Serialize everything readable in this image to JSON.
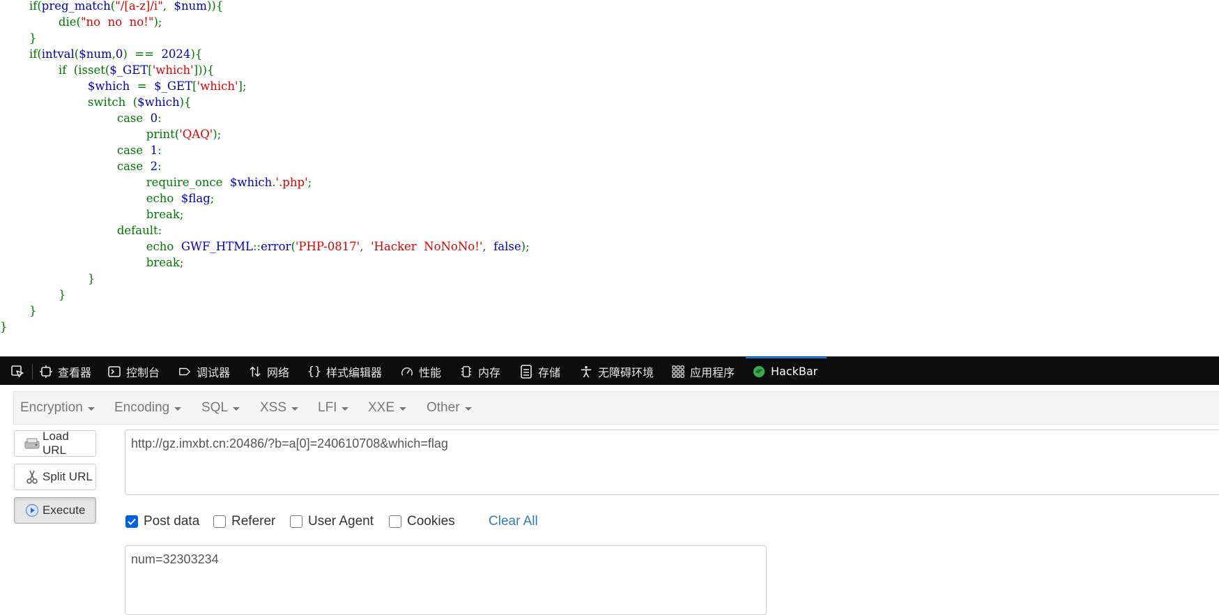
{
  "code": {
    "lines": [
      [
        {
          "t": "        if(",
          "c": "g"
        },
        {
          "t": "preg_match",
          "c": "b"
        },
        {
          "t": "(",
          "c": "g"
        },
        {
          "t": "\"/[a-z]/i\"",
          "c": "r"
        },
        {
          "t": ",  ",
          "c": "g"
        },
        {
          "t": "$num",
          "c": "b"
        },
        {
          "t": ")){",
          "c": "g"
        }
      ],
      [
        {
          "t": "                die(",
          "c": "g"
        },
        {
          "t": "\"no  no  no!\"",
          "c": "r"
        },
        {
          "t": ");",
          "c": "g"
        }
      ],
      [
        {
          "t": "        }",
          "c": "g"
        }
      ],
      [
        {
          "t": "        if(",
          "c": "g"
        },
        {
          "t": "intval",
          "c": "b"
        },
        {
          "t": "(",
          "c": "g"
        },
        {
          "t": "$num",
          "c": "b"
        },
        {
          "t": ",",
          "c": "g"
        },
        {
          "t": "0",
          "c": "b"
        },
        {
          "t": ")  ==  ",
          "c": "g"
        },
        {
          "t": "2024",
          "c": "b"
        },
        {
          "t": "){",
          "c": "g"
        }
      ],
      [
        {
          "t": "                if  (isset(",
          "c": "g"
        },
        {
          "t": "$_GET",
          "c": "b"
        },
        {
          "t": "[",
          "c": "g"
        },
        {
          "t": "'which'",
          "c": "r"
        },
        {
          "t": "])){",
          "c": "g"
        }
      ],
      [
        {
          "t": "                        ",
          "c": "g"
        },
        {
          "t": "$which",
          "c": "b"
        },
        {
          "t": "  =  ",
          "c": "g"
        },
        {
          "t": "$_GET",
          "c": "b"
        },
        {
          "t": "[",
          "c": "g"
        },
        {
          "t": "'which'",
          "c": "r"
        },
        {
          "t": "];",
          "c": "g"
        }
      ],
      [
        {
          "t": "                        switch  (",
          "c": "g"
        },
        {
          "t": "$which",
          "c": "b"
        },
        {
          "t": "){",
          "c": "g"
        }
      ],
      [
        {
          "t": "                                case  ",
          "c": "g"
        },
        {
          "t": "0",
          "c": "b"
        },
        {
          "t": ":",
          "c": "g"
        }
      ],
      [
        {
          "t": "                                        print(",
          "c": "g"
        },
        {
          "t": "'QAQ'",
          "c": "r"
        },
        {
          "t": ");",
          "c": "g"
        }
      ],
      [
        {
          "t": "                                case  ",
          "c": "g"
        },
        {
          "t": "1",
          "c": "b"
        },
        {
          "t": ":",
          "c": "g"
        }
      ],
      [
        {
          "t": "                                case  ",
          "c": "g"
        },
        {
          "t": "2",
          "c": "b"
        },
        {
          "t": ":",
          "c": "g"
        }
      ],
      [
        {
          "t": "                                        require_once  ",
          "c": "g"
        },
        {
          "t": "$which",
          "c": "b"
        },
        {
          "t": ".",
          "c": "g"
        },
        {
          "t": "'.php'",
          "c": "r"
        },
        {
          "t": ";",
          "c": "g"
        }
      ],
      [
        {
          "t": "                                        echo  ",
          "c": "g"
        },
        {
          "t": "$flag",
          "c": "b"
        },
        {
          "t": ";",
          "c": "g"
        }
      ],
      [
        {
          "t": "                                        break;",
          "c": "g"
        }
      ],
      [
        {
          "t": "                                default:",
          "c": "g"
        }
      ],
      [
        {
          "t": "                                        echo  ",
          "c": "g"
        },
        {
          "t": "GWF_HTML",
          "c": "b"
        },
        {
          "t": "::",
          "c": "g"
        },
        {
          "t": "error",
          "c": "b"
        },
        {
          "t": "(",
          "c": "g"
        },
        {
          "t": "'PHP-0817'",
          "c": "r"
        },
        {
          "t": ",  ",
          "c": "g"
        },
        {
          "t": "'Hacker  NoNoNo!'",
          "c": "r"
        },
        {
          "t": ",  ",
          "c": "g"
        },
        {
          "t": "false",
          "c": "b"
        },
        {
          "t": ");",
          "c": "g"
        }
      ],
      [
        {
          "t": "                                        break;",
          "c": "g"
        }
      ],
      [
        {
          "t": "                        }",
          "c": "g"
        }
      ],
      [
        {
          "t": "                }",
          "c": "g"
        }
      ],
      [
        {
          "t": "        }",
          "c": "g"
        }
      ],
      [
        {
          "t": "}",
          "c": "g"
        }
      ]
    ]
  },
  "devtools": {
    "tabs": [
      {
        "label": "查看器",
        "icon": "inspector-icon"
      },
      {
        "label": "控制台",
        "icon": "console-icon"
      },
      {
        "label": "调试器",
        "icon": "debugger-icon"
      },
      {
        "label": "网络",
        "icon": "network-icon"
      },
      {
        "label": "样式编辑器",
        "icon": "style-editor-icon"
      },
      {
        "label": "性能",
        "icon": "performance-icon"
      },
      {
        "label": "内存",
        "icon": "memory-icon"
      },
      {
        "label": "存储",
        "icon": "storage-icon"
      },
      {
        "label": "无障碍环境",
        "icon": "accessibility-icon"
      },
      {
        "label": "应用程序",
        "icon": "application-icon"
      },
      {
        "label": "HackBar",
        "icon": "hackbar-icon"
      }
    ],
    "active_tab": "HackBar",
    "accent_color": "#0a84ff"
  },
  "hackbar": {
    "menus": [
      "Encryption",
      "Encoding",
      "SQL",
      "XSS",
      "LFI",
      "XXE",
      "Other"
    ],
    "buttons": {
      "load_url": "Load URL",
      "split_url": "Split URL",
      "execute": "Execute"
    },
    "url_value": "http://gz.imxbt.cn:20486/?b=a[0]=240610708&which=flag",
    "options": {
      "post_data": {
        "label": "Post data",
        "checked": true
      },
      "referer": {
        "label": "Referer",
        "checked": false
      },
      "user_agent": {
        "label": "User Agent",
        "checked": false
      },
      "cookies": {
        "label": "Cookies",
        "checked": false
      }
    },
    "clear_all": "Clear All",
    "post_value": "num=32303234",
    "link_color": "#337ab7"
  }
}
